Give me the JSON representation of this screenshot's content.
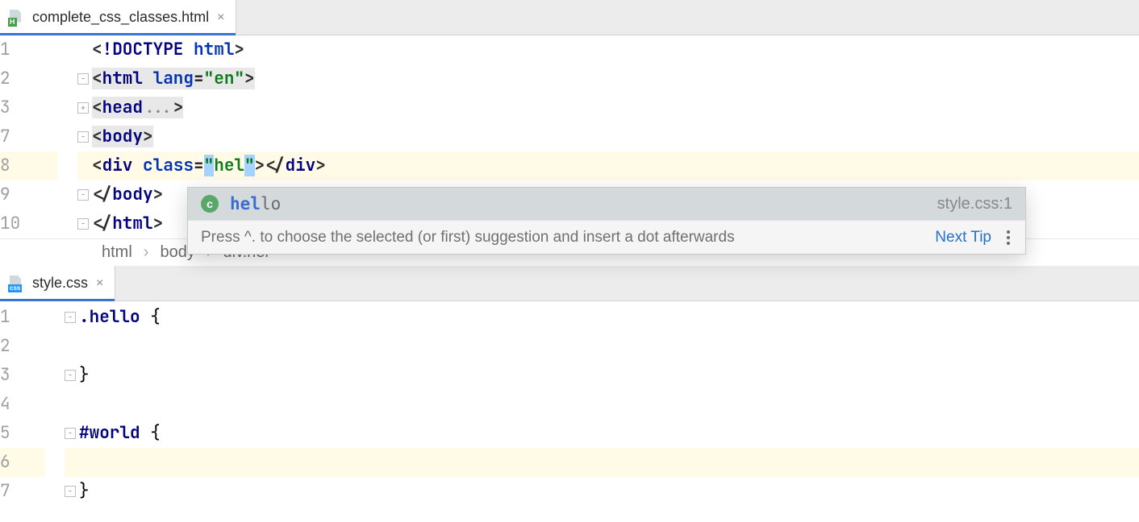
{
  "topPane": {
    "tab": {
      "filename": "complete_css_classes.html"
    },
    "lines": [
      {
        "num": "1",
        "fold": "",
        "hl": false,
        "segs": [
          {
            "t": "<",
            "c": "c-punct"
          },
          {
            "t": "!DOCTYPE ",
            "c": "c-tag"
          },
          {
            "t": "html",
            "c": "c-attr"
          },
          {
            "t": ">",
            "c": "c-punct"
          }
        ]
      },
      {
        "num": "2",
        "fold": "−",
        "hl": false,
        "segs": [
          {
            "t": "<",
            "c": "c-punct sel-bg"
          },
          {
            "t": "html ",
            "c": "c-tag sel-bg"
          },
          {
            "t": "lang",
            "c": "c-attr sel-bg"
          },
          {
            "t": "=",
            "c": "c-punct sel-bg"
          },
          {
            "t": "\"en\"",
            "c": "c-str sel-bg"
          },
          {
            "t": ">",
            "c": "c-punct sel-bg"
          }
        ]
      },
      {
        "num": "3",
        "fold": "+",
        "hl": false,
        "segs": [
          {
            "t": "<",
            "c": "c-punct sel-bg"
          },
          {
            "t": "head",
            "c": "c-tag sel-bg"
          },
          {
            "t": "...",
            "c": "sel-bg",
            "style": "color:#888"
          },
          {
            "t": ">",
            "c": "c-punct sel-bg"
          }
        ]
      },
      {
        "num": "7",
        "fold": "−",
        "hl": false,
        "segs": [
          {
            "t": "<",
            "c": "c-punct sel-bg"
          },
          {
            "t": "body",
            "c": "c-tag sel-bg"
          },
          {
            "t": ">",
            "c": "c-punct sel-bg"
          }
        ]
      },
      {
        "num": "8",
        "fold": "",
        "hl": true,
        "segs": [
          {
            "t": "<",
            "c": "c-punct"
          },
          {
            "t": "div ",
            "c": "c-tag"
          },
          {
            "t": "class",
            "c": "c-attr"
          },
          {
            "t": "=",
            "c": "c-punct"
          },
          {
            "t": "\"",
            "c": "c-str caret-span"
          },
          {
            "t": "hel",
            "c": "c-str"
          },
          {
            "t": "\"",
            "c": "c-str caret-span"
          },
          {
            "t": "></",
            "c": "c-punct"
          },
          {
            "t": "div",
            "c": "c-tag"
          },
          {
            "t": ">",
            "c": "c-punct"
          }
        ]
      },
      {
        "num": "9",
        "fold": "−",
        "hl": false,
        "segs": [
          {
            "t": "</",
            "c": "c-punct"
          },
          {
            "t": "body",
            "c": "c-tag"
          },
          {
            "t": ">",
            "c": "c-punct"
          }
        ]
      },
      {
        "num": "10",
        "fold": "−",
        "hl": false,
        "segs": [
          {
            "t": "</",
            "c": "c-punct"
          },
          {
            "t": "html",
            "c": "c-tag"
          },
          {
            "t": ">",
            "c": "c-punct"
          }
        ]
      }
    ],
    "breadcrumb": [
      "html",
      "body",
      "div.hel"
    ]
  },
  "completion": {
    "iconLetter": "c",
    "match": "hel",
    "rest": "lo",
    "source": "style.css:1",
    "hint": "Press ^. to choose the selected (or first) suggestion and insert a dot afterwards",
    "nextTip": "Next Tip"
  },
  "bottomPane": {
    "tab": {
      "filename": "style.css"
    },
    "lines": [
      {
        "num": "1",
        "fold": "−",
        "hl": false,
        "segs": [
          {
            "t": ".hello",
            "c": "c-sel"
          },
          {
            "t": " {",
            "c": ""
          }
        ]
      },
      {
        "num": "2",
        "fold": "",
        "hl": false,
        "segs": []
      },
      {
        "num": "3",
        "fold": "−",
        "hl": false,
        "segs": [
          {
            "t": "}",
            "c": ""
          }
        ]
      },
      {
        "num": "4",
        "fold": "",
        "hl": false,
        "segs": []
      },
      {
        "num": "5",
        "fold": "−",
        "hl": false,
        "segs": [
          {
            "t": "#world",
            "c": "c-sel"
          },
          {
            "t": " {",
            "c": ""
          }
        ]
      },
      {
        "num": "6",
        "fold": "",
        "hl": true,
        "segs": []
      },
      {
        "num": "7",
        "fold": "−",
        "hl": false,
        "segs": [
          {
            "t": "}",
            "c": ""
          }
        ]
      }
    ]
  }
}
